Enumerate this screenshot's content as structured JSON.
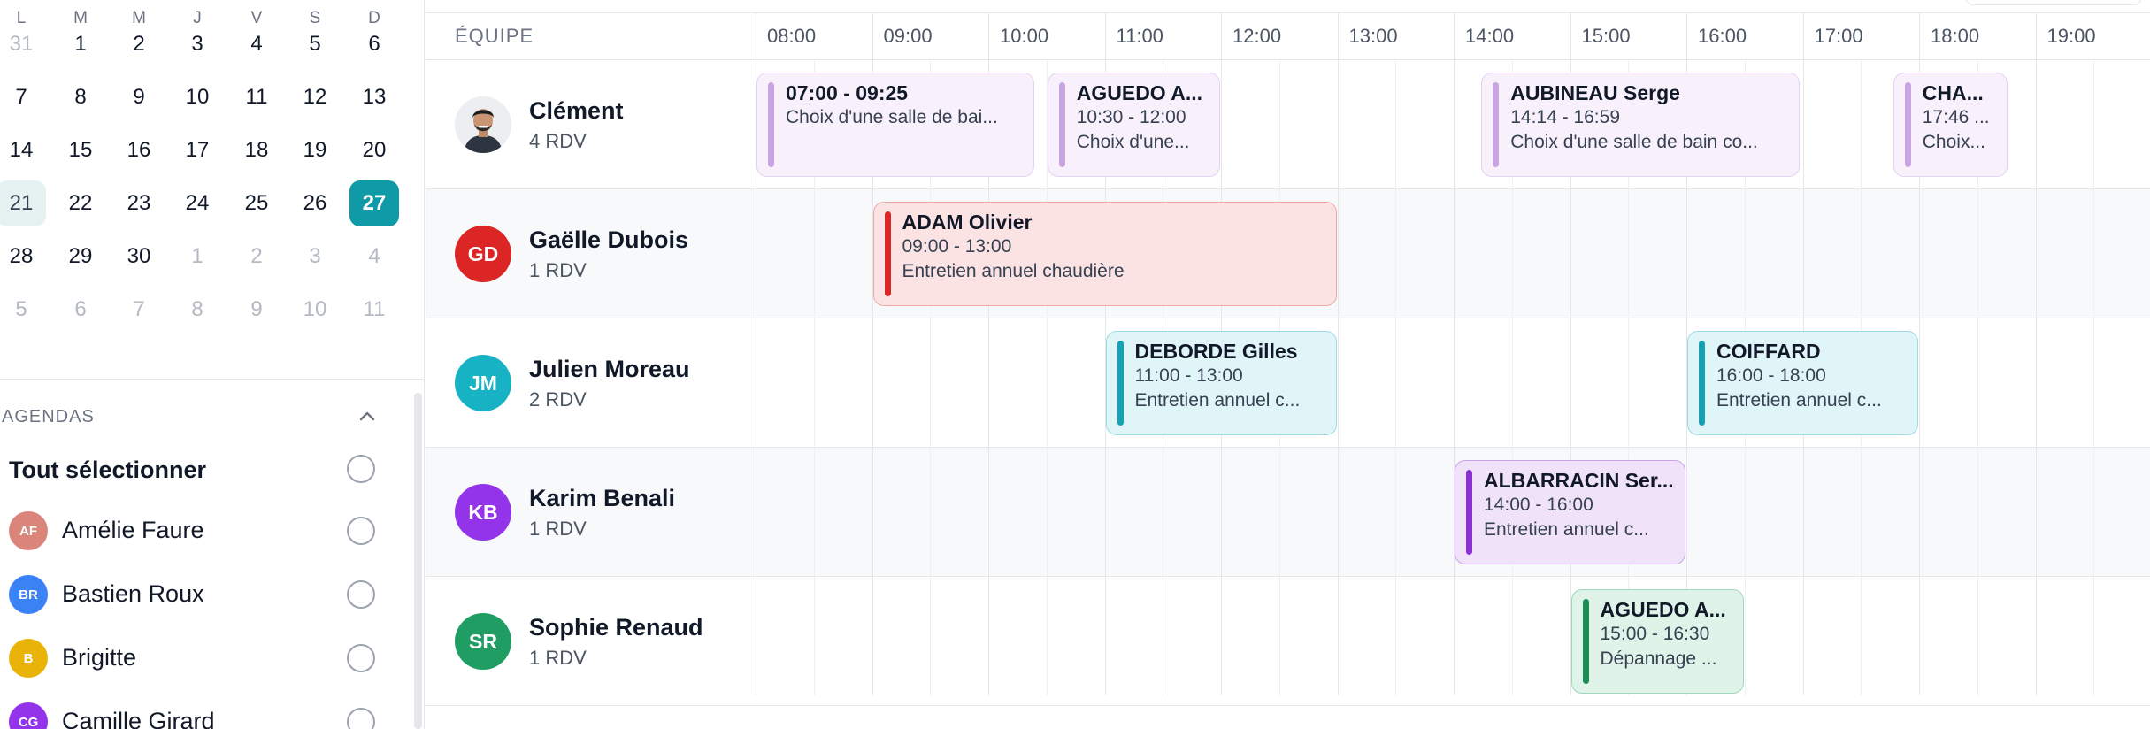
{
  "calendar": {
    "weekdays": [
      "L",
      "M",
      "M",
      "J",
      "V",
      "S",
      "D"
    ],
    "weeks": [
      [
        {
          "d": "31",
          "muted": true
        },
        {
          "d": "1"
        },
        {
          "d": "2"
        },
        {
          "d": "3"
        },
        {
          "d": "4"
        },
        {
          "d": "5"
        },
        {
          "d": "6"
        }
      ],
      [
        {
          "d": "7"
        },
        {
          "d": "8"
        },
        {
          "d": "9"
        },
        {
          "d": "10"
        },
        {
          "d": "11"
        },
        {
          "d": "12"
        },
        {
          "d": "13"
        }
      ],
      [
        {
          "d": "14"
        },
        {
          "d": "15"
        },
        {
          "d": "16"
        },
        {
          "d": "17"
        },
        {
          "d": "18"
        },
        {
          "d": "19"
        },
        {
          "d": "20"
        }
      ],
      [
        {
          "d": "21",
          "today": true
        },
        {
          "d": "22"
        },
        {
          "d": "23"
        },
        {
          "d": "24"
        },
        {
          "d": "25"
        },
        {
          "d": "26"
        },
        {
          "d": "27",
          "selected": true
        }
      ],
      [
        {
          "d": "28"
        },
        {
          "d": "29"
        },
        {
          "d": "30"
        },
        {
          "d": "1",
          "muted": true
        },
        {
          "d": "2",
          "muted": true
        },
        {
          "d": "3",
          "muted": true
        },
        {
          "d": "4",
          "muted": true
        }
      ],
      [
        {
          "d": "5",
          "muted": true
        },
        {
          "d": "6",
          "muted": true
        },
        {
          "d": "7",
          "muted": true
        },
        {
          "d": "8",
          "muted": true
        },
        {
          "d": "9",
          "muted": true
        },
        {
          "d": "10",
          "muted": true
        },
        {
          "d": "11",
          "muted": true
        }
      ]
    ]
  },
  "agendas": {
    "title": "AGENDAS",
    "select_all": "Tout sélectionner",
    "items": [
      {
        "initials": "AF",
        "name": "Amélie Faure",
        "color": "#d9857a"
      },
      {
        "initials": "BR",
        "name": "Bastien Roux",
        "color": "#3b82f6"
      },
      {
        "initials": "B",
        "name": "Brigitte",
        "color": "#eab308"
      },
      {
        "initials": "CG",
        "name": "Camille Girard",
        "color": "#9333ea"
      }
    ]
  },
  "scheduler": {
    "team_header": "ÉQUIPE",
    "hours": [
      "08:00",
      "09:00",
      "10:00",
      "11:00",
      "12:00",
      "13:00",
      "14:00",
      "15:00",
      "16:00",
      "17:00",
      "18:00",
      "19:00"
    ],
    "members": [
      {
        "name": "Clément",
        "count": "4 RDV",
        "initials": "",
        "photo": true,
        "color": "#e5e7eb",
        "events": [
          {
            "title": "07:00 - 09:25",
            "line2": "Choix d'une salle de bai...",
            "line3": "",
            "start": 8.0,
            "end": 10.4,
            "theme": "lavender"
          },
          {
            "title": "AGUEDO A...",
            "line2": "10:30 - 12:00",
            "line3": "Choix d'une...",
            "start": 10.5,
            "end": 12.0,
            "theme": "lavender"
          },
          {
            "title": "AUBINEAU Serge",
            "line2": "14:14 - 16:59",
            "line3": "Choix d'une salle de bain co...",
            "start": 14.23,
            "end": 16.98,
            "theme": "lavender"
          },
          {
            "title": "CHA...",
            "line2": "17:46 ...",
            "line3": "Choix...",
            "start": 17.77,
            "end": 18.77,
            "theme": "lavender"
          }
        ]
      },
      {
        "name": "Gaëlle Dubois",
        "count": "1 RDV",
        "initials": "GD",
        "photo": false,
        "color": "#dc2626",
        "events": [
          {
            "title": "ADAM Olivier",
            "line2": "09:00 - 13:00",
            "line3": "Entretien annuel chaudière",
            "start": 9.0,
            "end": 13.0,
            "theme": "red"
          }
        ]
      },
      {
        "name": "Julien Moreau",
        "count": "2 RDV",
        "initials": "JM",
        "photo": false,
        "color": "#17b3c4",
        "events": [
          {
            "title": "DEBORDE Gilles",
            "line2": "11:00 - 13:00",
            "line3": "Entretien annuel c...",
            "start": 11.0,
            "end": 13.0,
            "theme": "cyan"
          },
          {
            "title": "COIFFARD",
            "line2": "16:00 - 18:00",
            "line3": "Entretien annuel c...",
            "start": 16.0,
            "end": 18.0,
            "theme": "cyan"
          }
        ]
      },
      {
        "name": "Karim Benali",
        "count": "1 RDV",
        "initials": "KB",
        "photo": false,
        "color": "#9333ea",
        "events": [
          {
            "title": "ALBARRACIN Ser...",
            "line2": "14:00 - 16:00",
            "line3": "Entretien annuel c...",
            "start": 14.0,
            "end": 16.0,
            "theme": "purple"
          }
        ]
      },
      {
        "name": "Sophie Renaud",
        "count": "1 RDV",
        "initials": "SR",
        "photo": false,
        "color": "#1f9d63",
        "events": [
          {
            "title": "AGUEDO A...",
            "line2": "15:00 - 16:30",
            "line3": "Dépannage ...",
            "start": 15.0,
            "end": 16.5,
            "theme": "green"
          }
        ]
      }
    ]
  },
  "themes": {
    "lavender": {
      "bg": "#f8f1fc",
      "border": "#e5d2f2",
      "bar": "#c9a4e3"
    },
    "red": {
      "bg": "#fbe3e3",
      "border": "#f1a7a7",
      "bar": "#dc2626"
    },
    "cyan": {
      "bg": "#e0f5f7",
      "border": "#9fdbe2",
      "bar": "#17a2b3"
    },
    "purple": {
      "bg": "#f0e3f9",
      "border": "#c9a3e6",
      "bar": "#8b2fd6"
    },
    "green": {
      "bg": "#dff3e8",
      "border": "#9fd8b8",
      "bar": "#1a8f55"
    }
  }
}
